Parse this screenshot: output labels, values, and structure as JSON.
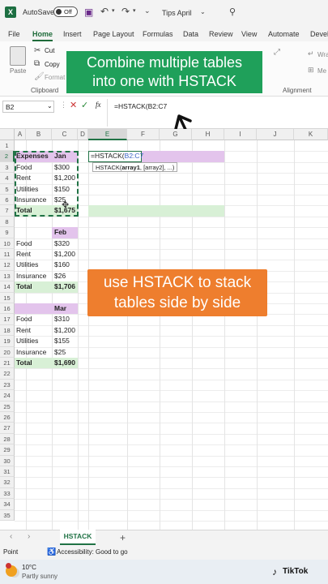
{
  "titlebar": {
    "autosave_label": "AutoSave",
    "autosave_state": "Off",
    "file_name": "Tips April",
    "app_icon": "excel-logo-icon"
  },
  "menu": {
    "items": [
      "File",
      "Home",
      "Insert",
      "Page Layout",
      "Formulas",
      "Data",
      "Review",
      "View",
      "Automate",
      "Devel"
    ],
    "active": "Home"
  },
  "ribbon": {
    "paste_label": "Paste",
    "cut_label": "Cut",
    "copy_label": "Copy",
    "format_painter_label": "Format P",
    "clipboard_group": "Clipboard",
    "alignment_group": "Alignment",
    "wrap_label": "Wra",
    "merge_label": "Me"
  },
  "formula_bar": {
    "name_box": "B2",
    "fx_label": "fx",
    "formula": "=HSTACK(B2:C7"
  },
  "banners": {
    "top": "Combine multiple tables\ninto one with HSTACK",
    "middle": "use HSTACK to stack\ntables side by side"
  },
  "columns": [
    "A",
    "B",
    "C",
    "D",
    "E",
    "F",
    "G",
    "H",
    "I",
    "J",
    "K"
  ],
  "rows": [
    "1",
    "2",
    "3",
    "4",
    "5",
    "6",
    "7",
    "8",
    "9",
    "10",
    "11",
    "12",
    "13",
    "14",
    "15",
    "16",
    "17",
    "18",
    "19",
    "20",
    "21",
    "22",
    "23",
    "24",
    "25",
    "26",
    "27",
    "28",
    "29",
    "30",
    "31",
    "32",
    "33",
    "34",
    "35"
  ],
  "tables": {
    "jan": {
      "header": [
        "Expenses",
        "Jan"
      ],
      "rows": [
        [
          "Food",
          "$300"
        ],
        [
          "Rent",
          "$1,200"
        ],
        [
          "Utilities",
          "$150"
        ],
        [
          "Insurance",
          "$25"
        ]
      ],
      "total": [
        "Total",
        "$1,675"
      ]
    },
    "feb": {
      "header": [
        "",
        "Feb"
      ],
      "rows": [
        [
          "Food",
          "$320"
        ],
        [
          "Rent",
          "$1,200"
        ],
        [
          "Utilities",
          "$160"
        ],
        [
          "Insurance",
          "$26"
        ]
      ],
      "total": [
        "Total",
        "$1,706"
      ]
    },
    "mar": {
      "header": [
        "",
        "Mar"
      ],
      "rows": [
        [
          "Food",
          "$310"
        ],
        [
          "Rent",
          "$1,200"
        ],
        [
          "Utilities",
          "$155"
        ],
        [
          "Insurance",
          "$25"
        ]
      ],
      "total": [
        "Total",
        "$1,690"
      ]
    }
  },
  "editing_cell": {
    "formula_prefix": "=HSTACK(",
    "formula_ref": "B2:C7",
    "tooltip_fn": "HSTACK(",
    "tooltip_arg1": "array1",
    "tooltip_rest": ", [array2], ...)"
  },
  "sheet_tabs": {
    "active": "HSTACK",
    "add": "+"
  },
  "status": {
    "ready": "Point",
    "accessibility": "Accessibility: Good to go"
  },
  "taskbar": {
    "temperature": "10°C",
    "weather": "Partly sunny",
    "watermark": "TikTok"
  },
  "colors": {
    "purple_header": "#e3c4ec",
    "green_total": "#d8f0d6",
    "green_banner": "#1fa05a",
    "orange_banner": "#ee7e2e",
    "selection_border": "#217346"
  }
}
